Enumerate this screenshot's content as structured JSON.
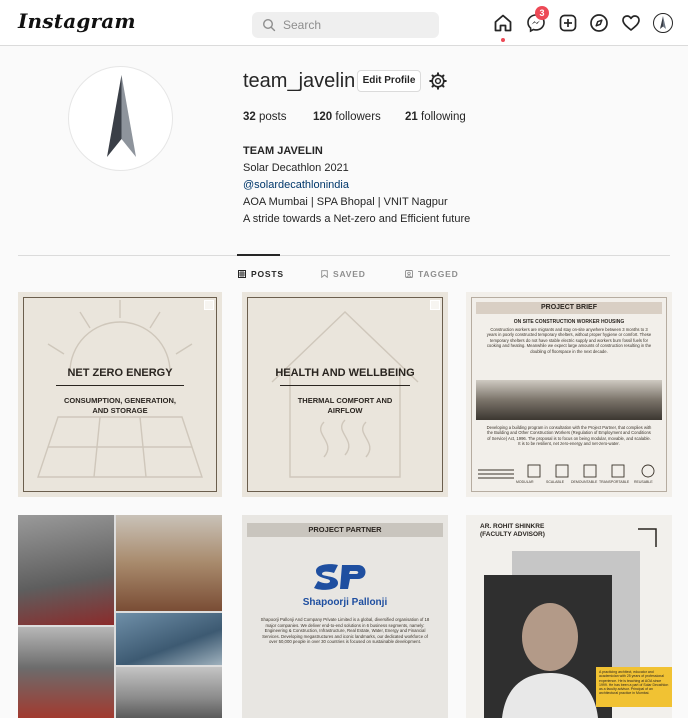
{
  "app": {
    "logo_text": "Instagram"
  },
  "search": {
    "placeholder": "Search"
  },
  "nav": {
    "icons": [
      "home-icon",
      "messenger-icon",
      "new-post-icon",
      "explore-icon",
      "activity-heart-icon",
      "profile-avatar-icon"
    ],
    "messages_badge": "3"
  },
  "profile": {
    "username": "team_javelin",
    "edit_button": "Edit Profile",
    "stats": {
      "posts_count": "32",
      "posts_label": "posts",
      "followers_count": "120",
      "followers_label": "followers",
      "following_count": "21",
      "following_label": "following"
    },
    "bio": {
      "name": "TEAM JAVELIN",
      "line1": "Solar Decathlon 2021",
      "handle": "@solardecathlonindia",
      "line3": "AOA Mumbai | SPA Bhopal | VNIT Nagpur",
      "line4": "A stride towards a Net-zero and Efficient future"
    }
  },
  "tabs": [
    {
      "label": "POSTS",
      "active": true
    },
    {
      "label": "SAVED",
      "active": false
    },
    {
      "label": "TAGGED",
      "active": false
    }
  ],
  "posts": [
    {
      "title": "NET ZERO ENERGY",
      "subtitle_line1": "CONSUMPTION, GENERATION,",
      "subtitle_line2": "AND STORAGE"
    },
    {
      "title": "HEALTH AND WELLBEING",
      "subtitle_line1": "THERMAL COMFORT AND",
      "subtitle_line2": "AIRFLOW"
    },
    {
      "title": "PROJECT BRIEF",
      "subtitle": "ON SITE CONSTRUCTION WORKER HOUSING",
      "para1": "Construction workers are migrants and stay on-site anywhere between 3 months to 3 years in poorly constructed temporary shelters, without proper hygiene or comfort. These temporary shelters do not have stable electric supply and workers burn fossil fuels for cooking and heating. Meanwhile we expect large amounts of construction resulting in the doubling of floorspace in the next decade.",
      "para2": "Developing a building program in consultation with the Project Partner, that complies with the Building and Other Construction Workers (Regulation of Employment and Conditions of Service) Act, 1996. The proposal is to focus on being modular, movable, and scalable. It is to be resilient, net zero-energy and net-zero-water.",
      "icon_labels": [
        "MODULAR",
        "SCALABLE",
        "DEMOUNTABLE",
        "TRANSPORTABLE",
        "REUSABLE"
      ]
    },
    {
      "type": "photo-collage"
    },
    {
      "title": "PROJECT PARTNER",
      "partner_name": "Shapoorji Pallonji",
      "text": "Shapoorji Pallonji And Company Private Limited is a global, diversified organisation of 18 major companies. We deliver end-to-end solutions in 6 business segments, namely: Engineering & Construction, Infrastructure, Real Estate, Water, Energy and Financial Services. Developing megastructures and iconic landmarks, our dedicated workforce of over 50,000 people in over 30 countries is focused on sustainable development."
    },
    {
      "title_line1": "AR. ROHIT SHINKRE",
      "title_line2": "(FACULTY ADVISOR)",
      "note": "A practicing architect, educator and academician with 25 years of professional experience. He is teaching at AOA since 1999. He has been a part of Solar Decathlon as a faculty advisor. Principal of an architectural practice in Mumbai."
    }
  ],
  "colors": {
    "accent_red": "#ed4956",
    "link_blue": "#00376b",
    "partner_blue": "#1f4fa0"
  }
}
